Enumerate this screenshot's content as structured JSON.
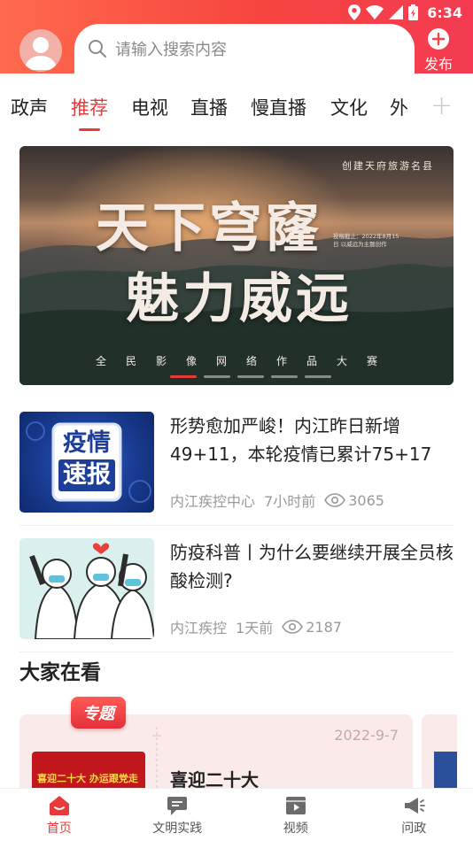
{
  "status_bar": {
    "time": "6:34"
  },
  "header": {
    "search_placeholder": "请输入搜索内容",
    "publish_label": "发布"
  },
  "tabs": [
    {
      "label": "政声",
      "active": false
    },
    {
      "label": "推荐",
      "active": true
    },
    {
      "label": "电视",
      "active": false
    },
    {
      "label": "直播",
      "active": false
    },
    {
      "label": "慢直播",
      "active": false
    },
    {
      "label": "文化",
      "active": false
    },
    {
      "label": "外",
      "active": false
    }
  ],
  "banner": {
    "tag": "创建天府旅游名县",
    "title_line1": "天下穹窿",
    "title_line2": "魅力威远",
    "deadline": "投稿截止：2022年8月15日 以威远为主题创作",
    "subtitle": "全民影像网络作品大赛",
    "slide_count": 5,
    "active_slide": 1
  },
  "news": [
    {
      "thumb_text_line1": "疫情",
      "thumb_text_line2": "速报",
      "title": "形势愈加严峻！内江昨日新增49+11，本轮疫情已累计75+17",
      "source": "内江疾控中心",
      "time": "7小时前",
      "views": "3065"
    },
    {
      "title": "防疫科普丨为什么要继续开展全员核酸检测?",
      "source": "内江疾控",
      "time": "1天前",
      "views": "2187"
    }
  ],
  "section": {
    "title": "大家在看",
    "card": {
      "badge": "专题",
      "date": "2022-9-7",
      "title": "喜迎二十大",
      "thumb_text": "喜迎二十大 办运跟党走"
    }
  },
  "bottom_nav": [
    {
      "label": "首页",
      "active": true,
      "icon": "home-icon"
    },
    {
      "label": "文明实践",
      "active": false,
      "icon": "chat-icon"
    },
    {
      "label": "视频",
      "active": false,
      "icon": "video-icon"
    },
    {
      "label": "问政",
      "active": false,
      "icon": "megaphone-icon"
    }
  ],
  "colors": {
    "accent": "#e83a3a",
    "header_start": "#ff6a4d",
    "header_end": "#f43b52"
  }
}
